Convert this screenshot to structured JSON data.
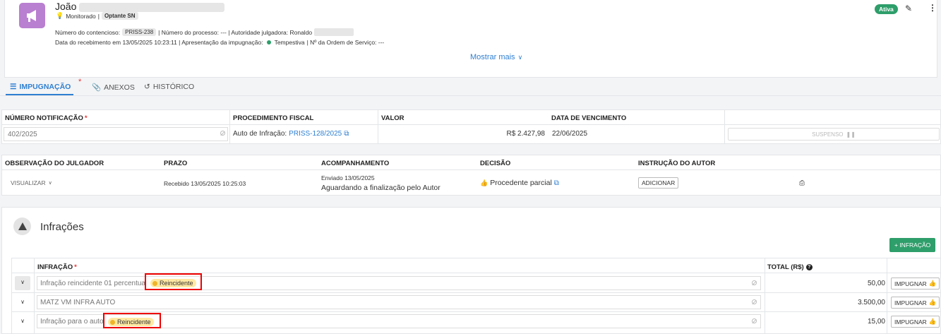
{
  "header": {
    "name": "João",
    "monitor_label": "Monitorado",
    "optante_badge": "Optante SN",
    "line1_a": "Número do contencioso:",
    "contencioso_badge": "PRISS-238",
    "line1_b": "| Número do processo: --- | Autoridade julgadora: Ronaldo",
    "line2_a": "Data do recebimento em 13/05/2025 10:23:11 | Apresentação da impugnação:",
    "line2_tempestiva": "Tempestiva",
    "line2_b": "| Nº da Ordem de Serviço: ---",
    "show_more": "Mostrar mais",
    "status_badge": "Ativa",
    "colors": {
      "accent": "#b97fd0",
      "green": "#2e9e6a",
      "blue": "#2f7fd1"
    }
  },
  "tabs": [
    {
      "label": "IMPUGNAÇÃO",
      "icon": "list-icon",
      "active": true,
      "required": "*"
    },
    {
      "label": "ANEXOS",
      "icon": "paperclip-icon"
    },
    {
      "label": "HISTÓRICO",
      "icon": "history-icon"
    }
  ],
  "notif": {
    "headers": {
      "numero": "NÚMERO NOTIFICAÇÃO",
      "required": "*",
      "procedimento": "PROCEDIMENTO FISCAL",
      "valor": "VALOR",
      "vencimento": "DATA DE VENCIMENTO"
    },
    "numero": "402/2025",
    "procedimento_prefix": "Auto de Infração:",
    "procedimento_link": "PRISS-128/2025",
    "valor": "R$ 2.427,98",
    "vencimento": "22/06/2025",
    "suspenso": "SUSPENSO"
  },
  "obs": {
    "headers": {
      "observacao": "OBSERVAÇÃO DO JULGADOR",
      "prazo": "PRAZO",
      "acompanhamento": "ACOMPANHAMENTO",
      "decisao": "DECISÃO",
      "instrucao": "INSTRUÇÃO DO AUTOR"
    },
    "visualizar": "VISUALIZAR",
    "prazo": "Recebido 13/05/2025 10:25:03",
    "enviado": "Enviado 13/05/2025",
    "acompanhamento": "Aguardando a finalização pelo Autor",
    "decisao": "Procedente parcial",
    "adicionar": "ADICIONAR"
  },
  "infracoes": {
    "title": "Infrações",
    "add_button": "+ INFRAÇÃO",
    "col_infracao": "INFRAÇÃO",
    "required": "*",
    "col_total": "TOTAL (R$)",
    "rows": [
      {
        "name": "Infração reincidente 01 percentua",
        "badge": "Reincidente",
        "total": "50,00",
        "action": "IMPUGNAR"
      },
      {
        "name": "MATZ VM INFRA AUTO",
        "badge": "",
        "total": "3.500,00",
        "action": "IMPUGNAR"
      },
      {
        "name": "Infração para o auto",
        "badge": "Reincidente",
        "total": "15,00",
        "action": "IMPUGNAR"
      }
    ]
  }
}
